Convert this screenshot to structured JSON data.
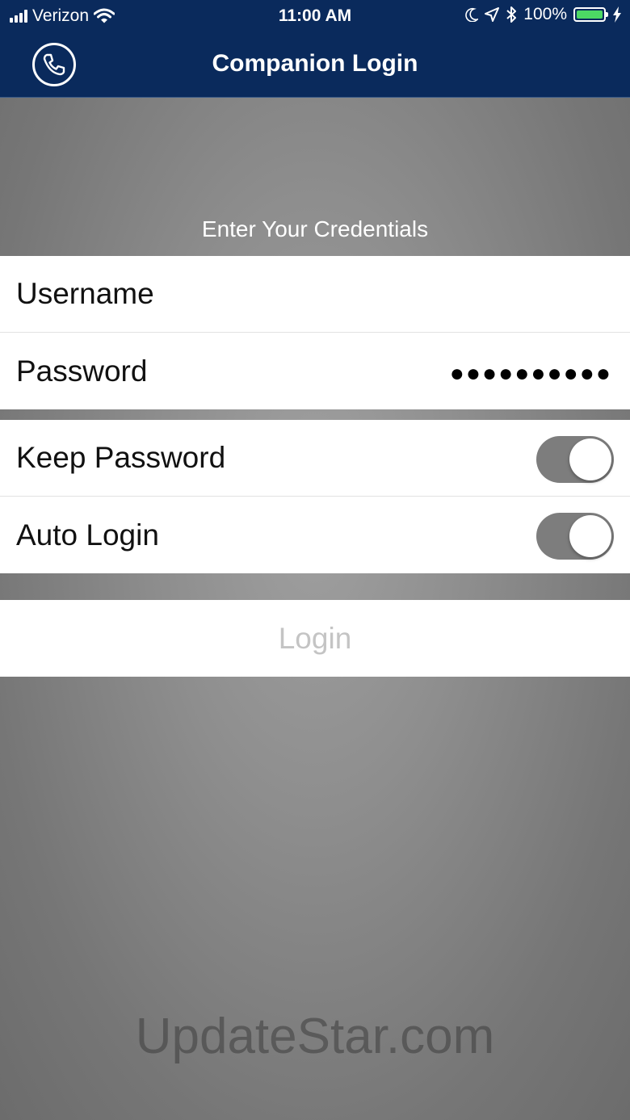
{
  "status_bar": {
    "carrier": "Verizon",
    "time": "11:00 AM",
    "battery": "100%",
    "battery_level": 1.0,
    "icons": [
      "signal-icon",
      "wifi-icon",
      "moon-icon",
      "location-arrow-icon",
      "bluetooth-icon",
      "battery-icon",
      "charging-bolt-icon"
    ]
  },
  "nav": {
    "title": "Companion Login",
    "left_icon": "phone-icon"
  },
  "credentials": {
    "header": "Enter Your Credentials",
    "username_label": "Username",
    "password_label": "Password",
    "password_value": "●●●●●●●●●●"
  },
  "options": {
    "keep_password_label": "Keep Password",
    "keep_password_on": true,
    "auto_login_label": "Auto Login",
    "auto_login_on": true
  },
  "login": {
    "label": "Login"
  },
  "watermark": "UpdateStar.com",
  "colors": {
    "nav_background": "#0a2a5c",
    "toggle_track": "#7d7d7d",
    "battery_fill": "#4cd964",
    "login_disabled_text": "#c4c4c4"
  }
}
